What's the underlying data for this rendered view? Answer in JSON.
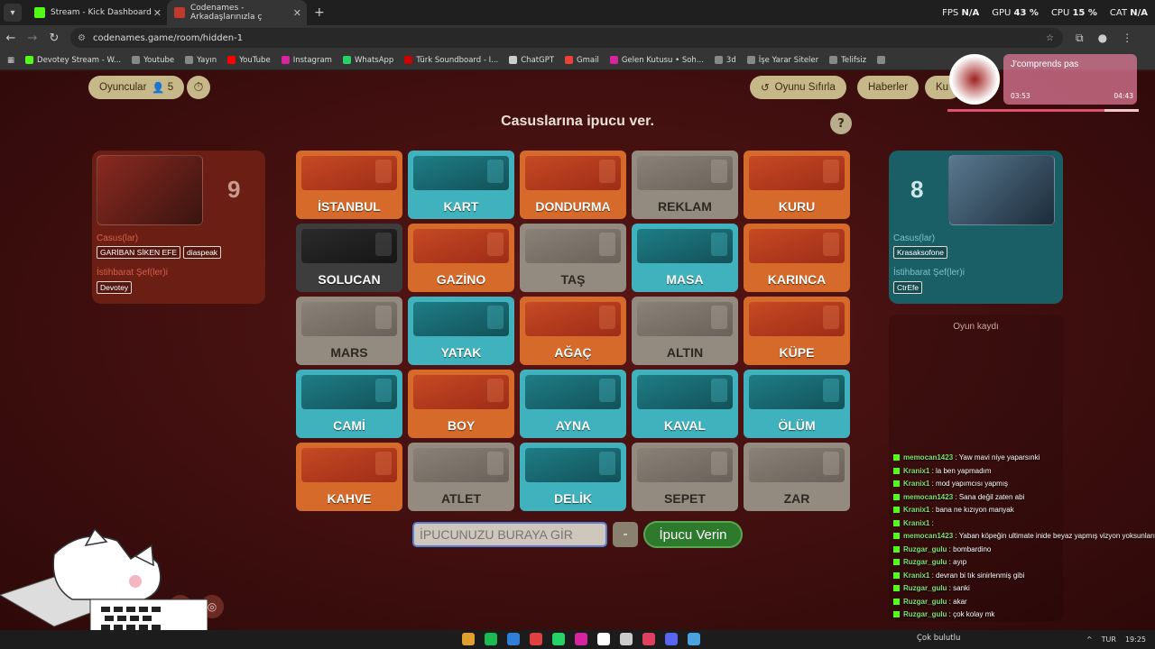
{
  "browser": {
    "tabs": [
      {
        "title": "Stream - Kick Dashboard",
        "active": false,
        "favicon_color": "#53fc18"
      },
      {
        "title": "Codenames - Arkadaşlarınızla ç",
        "active": true,
        "favicon_color": "#c0392b"
      }
    ],
    "new_tab": "+",
    "stats": {
      "fps_label": "FPS",
      "fps_value": "N/A",
      "gpu_label": "GPU",
      "gpu_value": "43 %",
      "cpu_label": "CPU",
      "cpu_value": "15 %",
      "cat_label": "CAT",
      "cat_value": "N/A"
    },
    "url": "codenames.game/room/hidden-1",
    "bookmarks": [
      {
        "label": "Devotey Stream - W...",
        "color": "#53fc18"
      },
      {
        "label": "Youtube",
        "color": "#888888"
      },
      {
        "label": "Yayın",
        "color": "#888888"
      },
      {
        "label": "YouTube",
        "color": "#ff0000"
      },
      {
        "label": "Instagram",
        "color": "#d6249f"
      },
      {
        "label": "WhatsApp",
        "color": "#25d366"
      },
      {
        "label": "Türk Soundboard - I...",
        "color": "#cc0000"
      },
      {
        "label": "ChatGPT",
        "color": "#cccccc"
      },
      {
        "label": "Gmail",
        "color": "#ea4335"
      },
      {
        "label": "Gelen Kutusu • Soh...",
        "color": "#d6249f"
      },
      {
        "label": "3d",
        "color": "#888888"
      },
      {
        "label": "İşe Yarar Siteler",
        "color": "#888888"
      },
      {
        "label": "Telifsiz",
        "color": "#888888"
      },
      {
        "label": "",
        "color": "#888888"
      }
    ]
  },
  "game": {
    "players_label": "Oyuncular",
    "players_count": "5",
    "reset_label": "Oyunu Sıfırla",
    "news_label": "Haberler",
    "partial_label": "Ku",
    "heading": "Casuslarına ipucu ver.",
    "help": "?",
    "red_team": {
      "score": "9",
      "spy_role": "Casus(lar)",
      "spies": [
        "GARİBAN SİKEN EFE",
        "diaspeak"
      ],
      "chief_role": "İstihbarat Şef(ler)i",
      "chiefs": [
        "Devotey"
      ]
    },
    "blue_team": {
      "score": "8",
      "spy_role": "Casus(lar)",
      "spies": [
        "Krasaksofone"
      ],
      "chief_role": "İstihbarat Şef(ler)i",
      "chiefs": [
        "CtrEfe"
      ]
    },
    "log_title": "Oyun kaydı",
    "cards": [
      {
        "word": "İSTANBUL",
        "team": "red"
      },
      {
        "word": "KART",
        "team": "blue"
      },
      {
        "word": "DONDURMA",
        "team": "red"
      },
      {
        "word": "REKLAM",
        "team": "neutral"
      },
      {
        "word": "KURU",
        "team": "red"
      },
      {
        "word": "SOLUCAN",
        "team": "assassin"
      },
      {
        "word": "GAZİNO",
        "team": "red"
      },
      {
        "word": "TAŞ",
        "team": "neutral"
      },
      {
        "word": "MASA",
        "team": "blue"
      },
      {
        "word": "KARINCA",
        "team": "red"
      },
      {
        "word": "MARS",
        "team": "neutral"
      },
      {
        "word": "YATAK",
        "team": "blue"
      },
      {
        "word": "AĞAÇ",
        "team": "red"
      },
      {
        "word": "ALTIN",
        "team": "neutral"
      },
      {
        "word": "KÜPE",
        "team": "red"
      },
      {
        "word": "CAMİ",
        "team": "blue"
      },
      {
        "word": "BOY",
        "team": "red"
      },
      {
        "word": "AYNA",
        "team": "blue"
      },
      {
        "word": "KAVAL",
        "team": "blue"
      },
      {
        "word": "ÖLÜM",
        "team": "blue"
      },
      {
        "word": "KAHVE",
        "team": "red"
      },
      {
        "word": "ATLET",
        "team": "neutral"
      },
      {
        "word": "DELİK",
        "team": "blue"
      },
      {
        "word": "SEPET",
        "team": "neutral"
      },
      {
        "word": "ZAR",
        "team": "neutral"
      }
    ],
    "clue_placeholder": "İPUCUNUZU BURAYA GİR",
    "clue_count": "-",
    "give_clue_label": "İpucu Verin"
  },
  "music": {
    "song": "J'comprends pas",
    "elapsed": "03:53",
    "total": "04:43",
    "progress": 0.82
  },
  "chat": [
    {
      "user": "memocan1423",
      "text": "Yaw mavi niye yaparsınki"
    },
    {
      "user": "Kranix1",
      "text": "la ben yapmadım"
    },
    {
      "user": "Kranix1",
      "text": "mod yapımcısı yapmış"
    },
    {
      "user": "memocan1423",
      "text": "Sana değil zaten abi"
    },
    {
      "user": "Kranix1",
      "text": "bana ne kızıyon manyak"
    },
    {
      "user": "Kranix1",
      "text": ""
    },
    {
      "user": "memocan1423",
      "text": "Yaban köpeğin ultimate inide beyaz yapmış vizyon yoksunları"
    },
    {
      "user": "Ruzgar_gulu",
      "text": "bombardino"
    },
    {
      "user": "Ruzgar_gulu",
      "text": "ayıp"
    },
    {
      "user": "Kranix1",
      "text": "devran bi tık sinirlenmiş gibi"
    },
    {
      "user": "Ruzgar_gulu",
      "text": "sanki"
    },
    {
      "user": "Ruzgar_gulu",
      "text": "akar"
    },
    {
      "user": "Ruzgar_gulu",
      "text": "çok kolay mk"
    }
  ],
  "taskbar": {
    "weather": "Çok bulutlu",
    "lang": "TUR",
    "time": "19:25",
    "icons": [
      "#e0a030",
      "#1db954",
      "#2f7fd8",
      "#e04040",
      "#25d366",
      "#d6249f",
      "#ffffff",
      "#cccccc",
      "#e04060",
      "#5865f2",
      "#4aa3df"
    ]
  }
}
